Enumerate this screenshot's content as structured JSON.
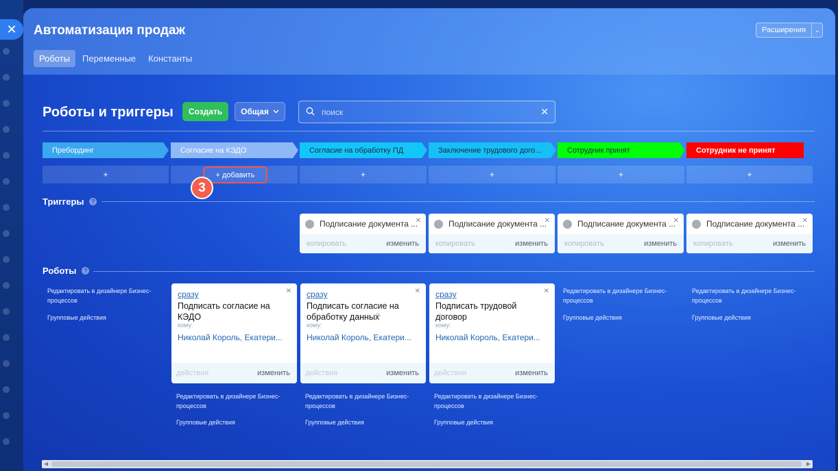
{
  "window": {
    "close_icon": "close-icon",
    "title": "Автоматизация продаж",
    "extensions_label": "Расширения"
  },
  "tabs": [
    {
      "label": "Роботы",
      "active": true
    },
    {
      "label": "Переменные",
      "active": false
    },
    {
      "label": "Константы",
      "active": false
    }
  ],
  "toolbar": {
    "section_title": "Роботы и триггеры",
    "create_label": "Создать",
    "common_label": "Общая",
    "search_placeholder": "поиск"
  },
  "stages": [
    {
      "name": "Пребординг",
      "color": "#3aa7f0"
    },
    {
      "name": "Согласие на КЭДО",
      "color": "#8fb8f7"
    },
    {
      "name": "Согласие на обработку ПД",
      "color": "#13c6f7"
    },
    {
      "name": "Заключение трудового дого...",
      "color": "#16bff5"
    },
    {
      "name": "Сотрудник принят",
      "color": "#00ff08"
    },
    {
      "name": "Сотрудник не принят",
      "color": "#ff0000"
    }
  ],
  "add_label": "+",
  "add_button_label": "+ добавить",
  "step_number": "3",
  "triggers": {
    "title": "Триггеры",
    "items": [
      {
        "name": "Подписание документа ...",
        "copy_label": "копировать",
        "edit_label": "изменить"
      },
      {
        "name": "Подписание документа ...",
        "copy_label": "копировать",
        "edit_label": "изменить"
      },
      {
        "name": "Подписание документа ...",
        "copy_label": "копировать",
        "edit_label": "изменить"
      },
      {
        "name": "Подписание документа ...",
        "copy_label": "копировать",
        "edit_label": "изменить"
      }
    ]
  },
  "robots": {
    "title": "Роботы",
    "bp_link": "Редактировать в дизайнере Бизнес-процессов",
    "group_actions": "Групповые действия",
    "items": [
      {
        "when": "сразу",
        "title": "Подписать согласие на КЭДО",
        "to_label": "кому:",
        "who": "Николай Король, Екатери...",
        "actions_label": "действия",
        "edit_label": "изменить"
      },
      {
        "when": "сразу",
        "title": "Подписать согласие на обработку данных",
        "to_label": "кому:",
        "who": "Николай Король, Екатери...",
        "actions_label": "действия",
        "edit_label": "изменить"
      },
      {
        "when": "сразу",
        "title": "Подписать трудовой договор",
        "to_label": "кому:",
        "who": "Николай Король, Екатери...",
        "actions_label": "действия",
        "edit_label": "изменить"
      }
    ]
  }
}
